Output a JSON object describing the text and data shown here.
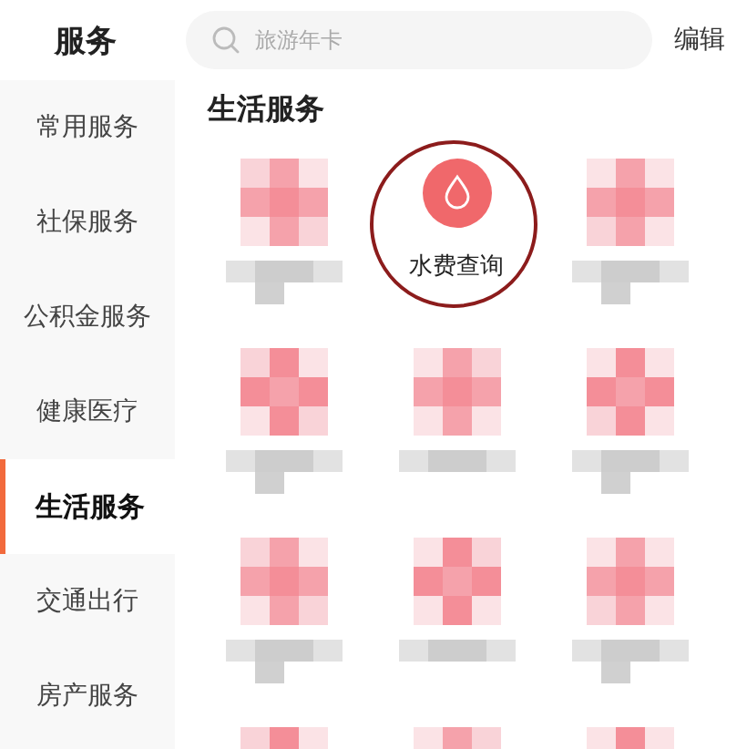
{
  "header": {
    "title": "服务",
    "search": {
      "placeholder": "旅游年卡"
    },
    "edit": "编辑"
  },
  "sidebar": {
    "items": [
      {
        "label": "常用服务",
        "selected": false
      },
      {
        "label": "社保服务",
        "selected": false
      },
      {
        "label": "公积金服务",
        "selected": false
      },
      {
        "label": "健康医疗",
        "selected": false
      },
      {
        "label": "生活服务",
        "selected": true
      },
      {
        "label": "交通出行",
        "selected": false
      },
      {
        "label": "房产服务",
        "selected": false
      }
    ]
  },
  "section": {
    "title": "生活服务",
    "services": [
      {
        "kind": "pixelated"
      },
      {
        "kind": "visible",
        "label": "水费查询",
        "circled": true
      },
      {
        "kind": "pixelated"
      },
      {
        "kind": "pixelated"
      },
      {
        "kind": "pixelated"
      },
      {
        "kind": "pixelated"
      },
      {
        "kind": "pixelated"
      },
      {
        "kind": "pixelated"
      },
      {
        "kind": "pixelated"
      },
      {
        "kind": "pixelated"
      },
      {
        "kind": "pixelated"
      },
      {
        "kind": "pixelated"
      }
    ]
  }
}
